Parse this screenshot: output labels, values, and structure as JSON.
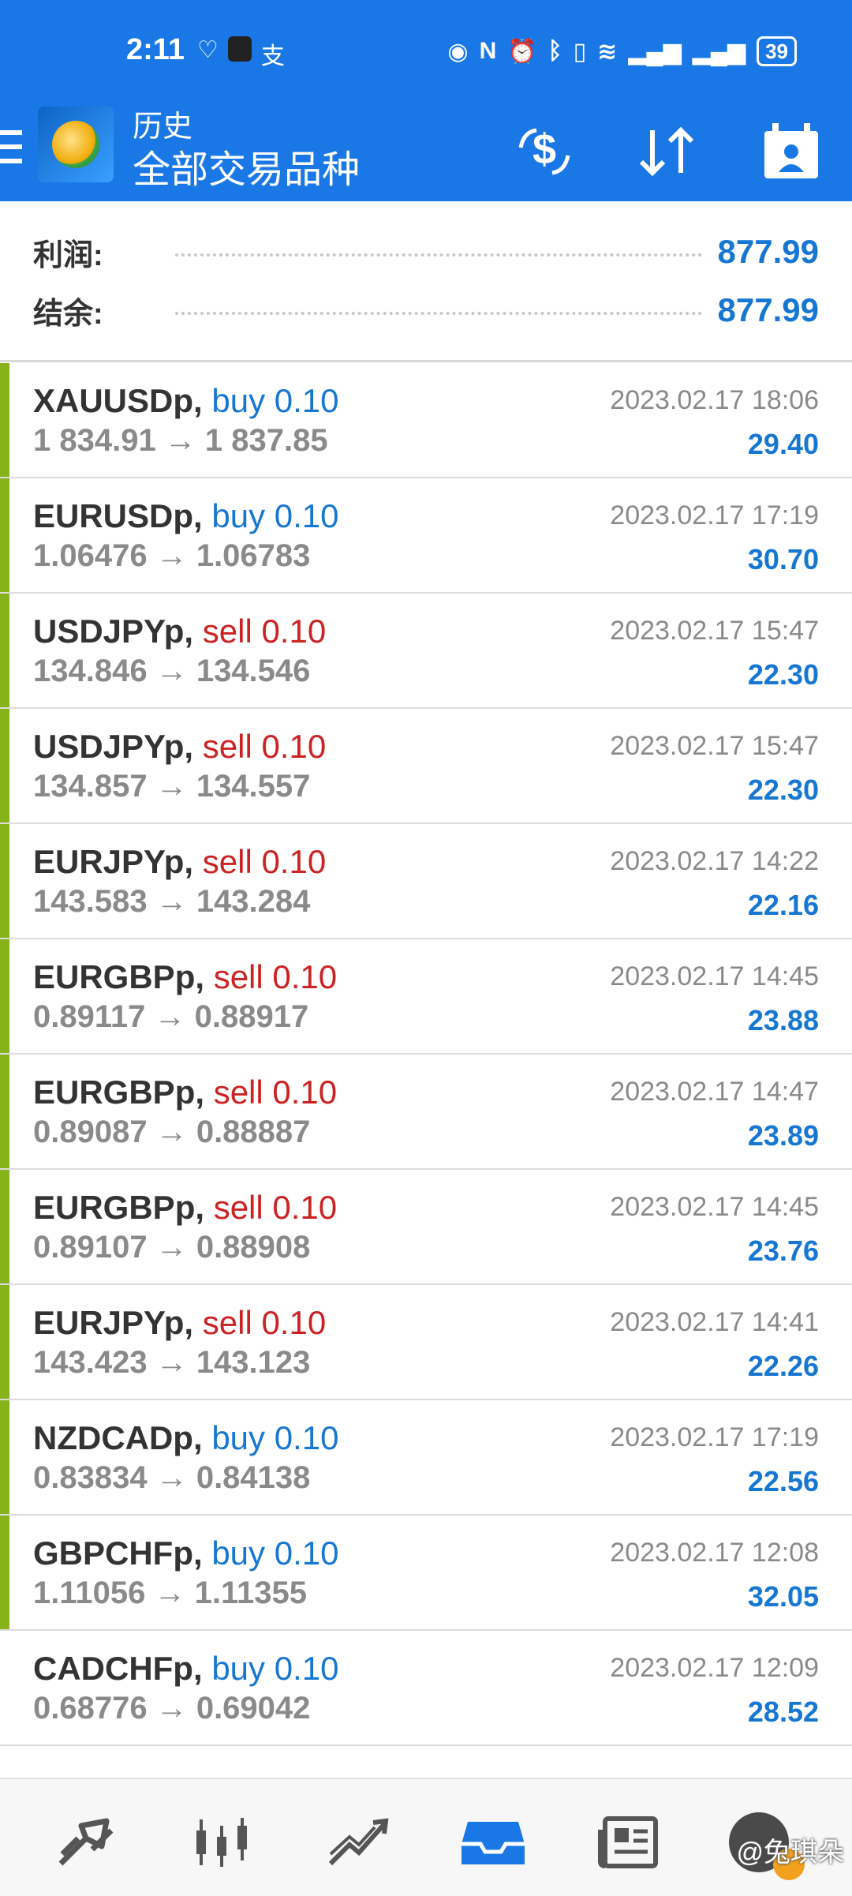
{
  "status_bar": {
    "time": "2:11",
    "left_icons": [
      "heart-check-icon",
      "soul-app-icon",
      "alipay-icon"
    ],
    "right_icons": [
      "eye-icon",
      "nfc-icon",
      "alarm-icon",
      "bluetooth-icon",
      "vibrate-icon",
      "wifi-icon",
      "signal-4g-icon",
      "signal-2g-icon"
    ],
    "battery": "39"
  },
  "app_bar": {
    "title_small": "历史",
    "title_big": "全部交易品种"
  },
  "summary": {
    "profit_label": "利润:",
    "profit_value": "877.99",
    "balance_label": "结余:",
    "balance_value": "877.99"
  },
  "trades": [
    {
      "symbol": "XAUUSDp,",
      "side": "buy 0.10",
      "type": "buy",
      "prices": "1 834.91 → 1 837.85",
      "datetime": "2023.02.17 18:06",
      "profit": "29.40"
    },
    {
      "symbol": "EURUSDp,",
      "side": "buy 0.10",
      "type": "buy",
      "prices": "1.06476 → 1.06783",
      "datetime": "2023.02.17 17:19",
      "profit": "30.70"
    },
    {
      "symbol": "USDJPYp,",
      "side": "sell 0.10",
      "type": "sell",
      "prices": "134.846 → 134.546",
      "datetime": "2023.02.17 15:47",
      "profit": "22.30"
    },
    {
      "symbol": "USDJPYp,",
      "side": "sell 0.10",
      "type": "sell",
      "prices": "134.857 → 134.557",
      "datetime": "2023.02.17 15:47",
      "profit": "22.30"
    },
    {
      "symbol": "EURJPYp,",
      "side": "sell 0.10",
      "type": "sell",
      "prices": "143.583 → 143.284",
      "datetime": "2023.02.17 14:22",
      "profit": "22.16"
    },
    {
      "symbol": "EURGBPp,",
      "side": "sell 0.10",
      "type": "sell",
      "prices": "0.89117 → 0.88917",
      "datetime": "2023.02.17 14:45",
      "profit": "23.88"
    },
    {
      "symbol": "EURGBPp,",
      "side": "sell 0.10",
      "type": "sell",
      "prices": "0.89087 → 0.88887",
      "datetime": "2023.02.17 14:47",
      "profit": "23.89"
    },
    {
      "symbol": "EURGBPp,",
      "side": "sell 0.10",
      "type": "sell",
      "prices": "0.89107 → 0.88908",
      "datetime": "2023.02.17 14:45",
      "profit": "23.76"
    },
    {
      "symbol": "EURJPYp,",
      "side": "sell 0.10",
      "type": "sell",
      "prices": "143.423 → 143.123",
      "datetime": "2023.02.17 14:41",
      "profit": "22.26"
    },
    {
      "symbol": "NZDCADp,",
      "side": "buy 0.10",
      "type": "buy",
      "prices": "0.83834 → 0.84138",
      "datetime": "2023.02.17 17:19",
      "profit": "22.56"
    },
    {
      "symbol": "GBPCHFp,",
      "side": "buy 0.10",
      "type": "buy",
      "prices": "1.11056 → 1.11355",
      "datetime": "2023.02.17 12:08",
      "profit": "32.05"
    },
    {
      "symbol": "CADCHFp,",
      "side": "buy 0.10",
      "type": "buy",
      "prices": "0.68776 → 0.69042",
      "datetime": "2023.02.17 12:09",
      "profit": "28.52"
    }
  ],
  "bottom_nav": {
    "items": [
      "quotes-icon",
      "chart-icon",
      "trade-icon",
      "history-icon",
      "news-icon",
      "messages-icon"
    ],
    "watermark": "@兔琪朵"
  },
  "colors": {
    "primary": "#1a78e6",
    "buy": "#1677d2",
    "sell": "#cc2222",
    "profit": "#1677d2",
    "row_bar": "#86b21a"
  }
}
